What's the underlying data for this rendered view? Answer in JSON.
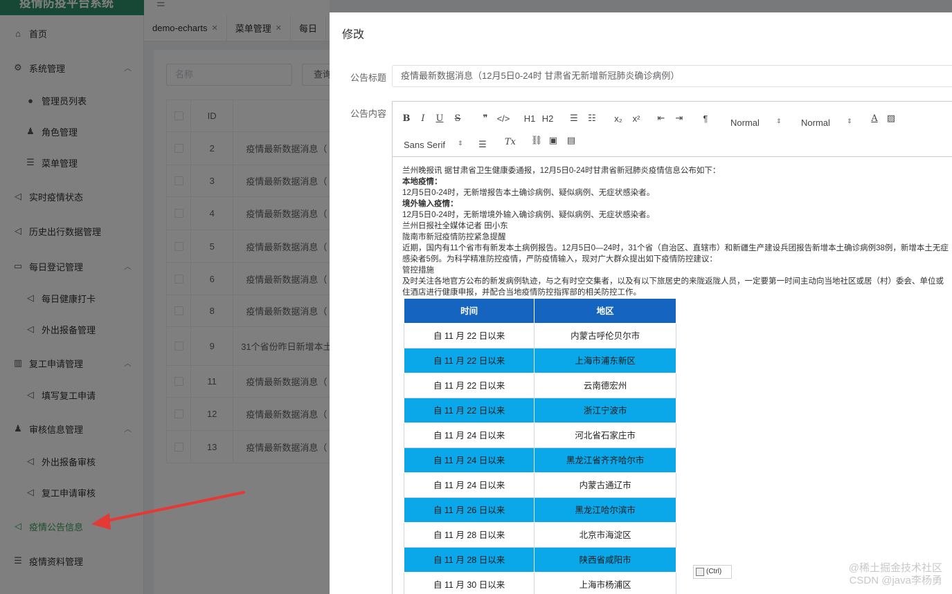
{
  "app": {
    "title": "疫情防疫平台系统"
  },
  "sidebar": {
    "items": [
      {
        "label": "首页",
        "icon": "home-icon"
      },
      {
        "label": "系统管理",
        "icon": "gear-icon"
      },
      {
        "label": "管理员列表",
        "icon": "user-icon"
      },
      {
        "label": "角色管理",
        "icon": "role-icon"
      },
      {
        "label": "菜单管理",
        "icon": "list-icon"
      },
      {
        "label": "实时疫情状态",
        "icon": "send-icon"
      },
      {
        "label": "历史出行数据管理",
        "icon": "send-icon"
      },
      {
        "label": "每日登记管理",
        "icon": "chat-icon"
      },
      {
        "label": "每日健康打卡",
        "icon": "send-icon"
      },
      {
        "label": "外出报备管理",
        "icon": "send-icon"
      },
      {
        "label": "复工申请管理",
        "icon": "bar-chart-icon"
      },
      {
        "label": "填写复工申请",
        "icon": "send-icon"
      },
      {
        "label": "审核信息管理",
        "icon": "user-icon"
      },
      {
        "label": "外出报备审核",
        "icon": "send-icon"
      },
      {
        "label": "复工申请审核",
        "icon": "send-icon"
      },
      {
        "label": "疫情公告信息",
        "icon": "send-icon"
      },
      {
        "label": "疫情资料管理",
        "icon": "list-icon"
      }
    ]
  },
  "tabs": [
    {
      "label": "demo-echarts"
    },
    {
      "label": "菜单管理"
    },
    {
      "label": "每日"
    }
  ],
  "main": {
    "search_placeholder": "名称",
    "query_label": "查询",
    "table": {
      "header_id": "ID",
      "rows": [
        {
          "id": "2",
          "title": "疫情最新数据消息（"
        },
        {
          "id": "3",
          "title": "疫情最新数据消息（"
        },
        {
          "id": "4",
          "title": "疫情最新数据消息（"
        },
        {
          "id": "5",
          "title": "疫情最新数据消息（"
        },
        {
          "id": "6",
          "title": "疫情最新数据消息（"
        },
        {
          "id": "8",
          "title": "疫情最新数据消息（"
        },
        {
          "id": "9",
          "title": "31个省份昨日新增本土"
        },
        {
          "id": "11",
          "title": "疫情最新数据消息（"
        },
        {
          "id": "12",
          "title": "疫情最新数据消息（"
        },
        {
          "id": "13",
          "title": "疫情最新数据消息（"
        }
      ]
    }
  },
  "dialog": {
    "title": "修改",
    "title_label": "公告标题",
    "title_value": "疫情最新数据消息（12月5日0-24时 甘肃省无新增新冠肺炎确诊病例）",
    "content_label": "公告内容",
    "toolbar": {
      "header_picker": "Normal",
      "size_picker": "Normal",
      "font_picker": "Sans Serif",
      "h1": "H1",
      "h2": "H2"
    },
    "content": {
      "lines": [
        {
          "text": "兰州晚报讯 据甘肃省卫生健康委通报，12月5日0-24时甘肃省新冠肺炎疫情信息公布如下：",
          "bold": false
        },
        {
          "text": "本地疫情：",
          "bold": true
        },
        {
          "text": "12月5日0-24时，无新增报告本土确诊病例、疑似病例、无症状感染者。",
          "bold": false
        },
        {
          "text": "境外输入疫情：",
          "bold": true
        },
        {
          "text": "12月5日0-24时，无新增境外输入确诊病例、疑似病例、无症状感染者。",
          "bold": false
        },
        {
          "text": "兰州日报社全媒体记者 田小东",
          "bold": false
        },
        {
          "text": "陇南市新冠疫情防控紧急提醒",
          "bold": false
        },
        {
          "text": "近期，国内有11个省市有新发本土病例报告。12月5日0—24时，31个省（自治区、直辖市）和新疆生产建设兵团报告新增本土确诊病例38例，新增本土无症",
          "bold": false
        },
        {
          "text": "感染者5例。为科学精准防控疫情，严防疫情输入，现对广大群众提出如下疫情防控建议：",
          "bold": false
        },
        {
          "text": "管控措施",
          "bold": false
        },
        {
          "text": "及时关注各地官方公布的新发病例轨迹，与之有时空交集者，以及有以下旅居史的来陇返陇人员，一定要第一时间主动向当地社区或居（村）委会、单位或",
          "bold": false
        },
        {
          "text": "住酒店进行健康申报，并配合当地疫情防控指挥部的相关防控工作。",
          "bold": false
        }
      ],
      "table": {
        "headers": [
          "时间",
          "地区"
        ],
        "rows": [
          {
            "time": "自 11 月 22 日以来",
            "area": "内蒙古呼伦贝尔市"
          },
          {
            "time": "自 11 月 22 日以来",
            "area": "上海市浦东新区"
          },
          {
            "time": "自 11 月 22 日以来",
            "area": "云南德宏州"
          },
          {
            "time": "自 11 月 22 日以来",
            "area": "浙江宁波市"
          },
          {
            "time": "自 11 月 24 日以来",
            "area": "河北省石家庄市"
          },
          {
            "time": "自 11 月 24 日以来",
            "area": "黑龙江省齐齐哈尔市"
          },
          {
            "time": "自 11 月 24 日以来",
            "area": "内蒙古通辽市"
          },
          {
            "time": "自 11 月 26 日以来",
            "area": "黑龙江哈尔滨市"
          },
          {
            "time": "自 11 月 28 日以来",
            "area": "北京市海淀区"
          },
          {
            "time": "自 11 月 28 日以来",
            "area": "陕西省咸阳市"
          },
          {
            "time": "自 11 月 30 日以来",
            "area": "上海市杨浦区"
          }
        ]
      },
      "paste_hint": "(Ctrl)"
    }
  },
  "watermark": {
    "line1": "@稀土掘金技术社区",
    "line2": "CSDN @java李杨勇"
  },
  "colors": {
    "sidebar_active": "#3b9e58",
    "table_header": "#1565c0",
    "table_highlight": "#0aa8e8",
    "annotation_arrow": "#e53935"
  }
}
